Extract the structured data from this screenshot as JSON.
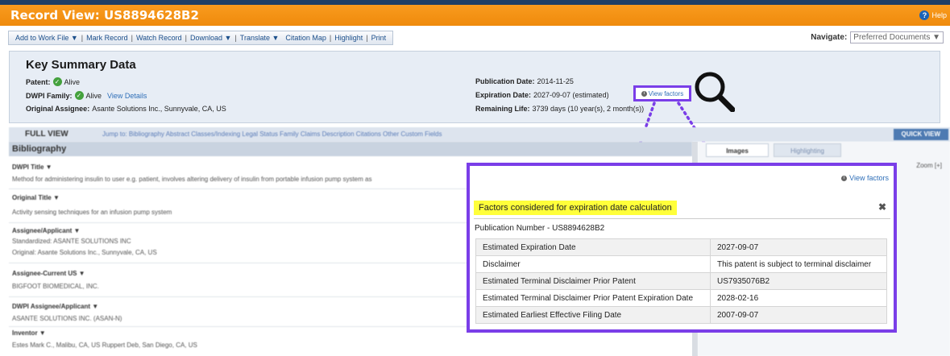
{
  "window": {
    "title": "Record View: US8894628B2",
    "help_label": "Help",
    "help_icon": "help-icon"
  },
  "toolbar": {
    "items": [
      "Add to Work File ▼",
      "Mark Record",
      "Watch Record",
      "Download ▼",
      "Translate ▼",
      "Citation Map",
      "Highlight",
      "Print"
    ],
    "separator": "|"
  },
  "navigate": {
    "label": "Navigate:",
    "value": "Preferred Documents ▼"
  },
  "summary": {
    "heading": "Key Summary Data",
    "patent_label": "Patent:",
    "patent_status": "Alive",
    "dwpi_label": "DWPI Family:",
    "dwpi_status": "Alive",
    "dwpi_link": "View Details",
    "assignee_label": "Original Assignee:",
    "assignee_value": "Asante Solutions Inc., Sunnyvale, CA, US",
    "pubdate_label": "Publication Date:",
    "pubdate_value": "2014-11-25",
    "expdate_label": "Expiration Date:",
    "expdate_value": "2027-09-07 (estimated)",
    "view_factors_label": "View factors",
    "remaining_label": "Remaining Life:",
    "remaining_value": "3739 days (10 year(s), 2 month(s))"
  },
  "fullview": {
    "title": "FULL VIEW",
    "links": "Jump to: Bibliography  Abstract  Classes/Indexing  Legal Status  Family  Claims  Description  Citations  Other  Custom Fields",
    "quick_view": "QUICK VIEW"
  },
  "bibliography": {
    "heading": "Bibliography",
    "fields": [
      {
        "label": "DWPI Title ▼",
        "value": "Method for administering insulin to user e.g. patient, involves altering delivery of insulin from portable infusion pump system as"
      },
      {
        "label": "Original Title ▼",
        "value": "Activity sensing techniques for an infusion pump system"
      },
      {
        "label": "Assignee/Applicant ▼",
        "value": "Standardized: ASANTE SOLUTIONS INC",
        "value2": "Original: Asante Solutions Inc., Sunnyvale, CA, US"
      },
      {
        "label": "Assignee-Current US ▼",
        "value": "BIGFOOT BIOMEDICAL, INC."
      },
      {
        "label": "DWPI Assignee/Applicant ▼",
        "value": "ASANTE SOLUTIONS INC. (ASAN-N)"
      },
      {
        "label": "Inventor ▼",
        "value": "Estes Mark C., Malibu, CA, US   Ruppert Deb, San Diego, CA, US"
      }
    ]
  },
  "right_panel": {
    "tabs": [
      "Images",
      "Highlighting"
    ],
    "zoom": "Zoom [+]"
  },
  "popup": {
    "view_factors_label": "View factors",
    "title": "Factors considered for expiration date calculation",
    "close_label": "✖",
    "publication_number": "Publication Number - US8894628B2",
    "rows": [
      [
        "Estimated Expiration Date",
        "2027-09-07"
      ],
      [
        "Disclaimer",
        "This patent is subject to terminal disclaimer"
      ],
      [
        "Estimated Terminal Disclaimer Prior Patent",
        "US7935076B2"
      ],
      [
        "Estimated Terminal Disclaimer Prior Patent Expiration Date",
        "2028-02-16"
      ],
      [
        "Estimated Earliest Effective Filing Date",
        "2007-09-07"
      ]
    ]
  },
  "colors": {
    "title_bar": "#f4921a",
    "highlight_border": "#7a3ee8",
    "popup_title_bg": "#ffff3a",
    "alive_green": "#44a13d"
  }
}
